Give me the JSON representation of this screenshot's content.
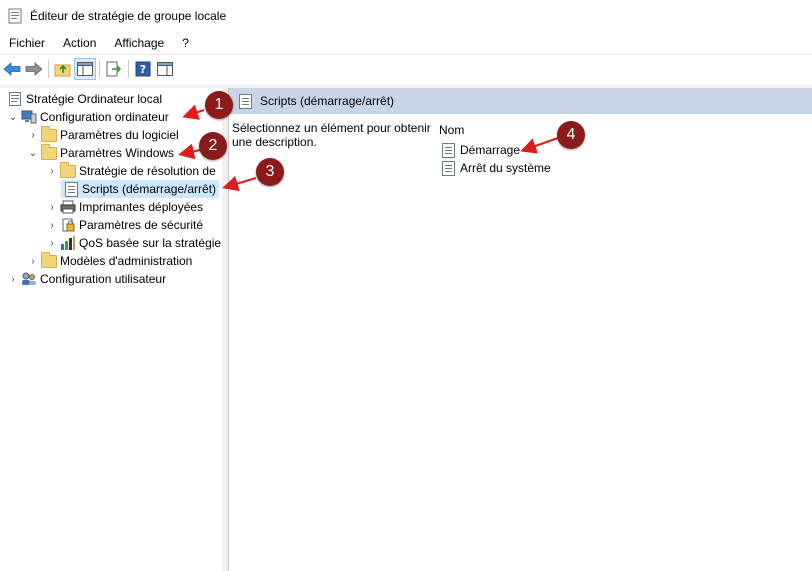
{
  "window": {
    "title": "Éditeur de stratégie de groupe locale"
  },
  "menu": [
    "Fichier",
    "Action",
    "Affichage",
    "?"
  ],
  "tree": {
    "root": "Stratégie Ordinateur local",
    "computer_config": "Configuration ordinateur",
    "software_settings": "Paramètres du logiciel",
    "windows_settings": "Paramètres Windows",
    "name_resolution": "Stratégie de résolution de",
    "scripts": "Scripts (démarrage/arrêt)",
    "printers": "Imprimantes déployées",
    "security": "Paramètres de sécurité",
    "qos": "QoS basée sur la stratégie",
    "admin_templates": "Modèles d'administration",
    "user_config": "Configuration utilisateur"
  },
  "content": {
    "header": "Scripts (démarrage/arrêt)",
    "description": "Sélectionnez un élément pour obtenir une description.",
    "column_name": "Nom",
    "items": [
      "Démarrage",
      "Arrêt du système"
    ]
  },
  "annotations": [
    "1",
    "2",
    "3",
    "4"
  ],
  "colors": {
    "badge": "#8b1a1a",
    "arrow": "#e11b1b",
    "selected": "#cce8ff",
    "header": "#c7d5e6"
  }
}
